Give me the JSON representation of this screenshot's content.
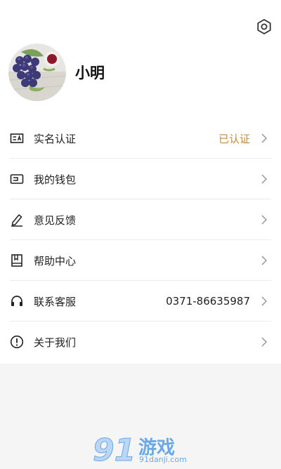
{
  "profile": {
    "username": "小明"
  },
  "menu": [
    {
      "label": "实名认证",
      "value": "已认证"
    },
    {
      "label": "我的钱包",
      "value": ""
    },
    {
      "label": "意见反馈",
      "value": ""
    },
    {
      "label": "帮助中心",
      "value": ""
    },
    {
      "label": "联系客服",
      "value": "0371-86635987"
    },
    {
      "label": "关于我们",
      "value": ""
    }
  ],
  "icons": {
    "settings": "gear-icon",
    "verify": "id-card-icon",
    "wallet": "wallet-icon",
    "feedback": "pencil-icon",
    "help": "book-icon",
    "service": "headphones-icon",
    "about": "info-icon",
    "arrow": "chevron-right-icon"
  },
  "colors": {
    "verified": "#c78a3c",
    "watermark": "#6aa9e8"
  },
  "watermark": {
    "logo_digits": "91",
    "text": "游戏",
    "url": "91danji.com"
  }
}
